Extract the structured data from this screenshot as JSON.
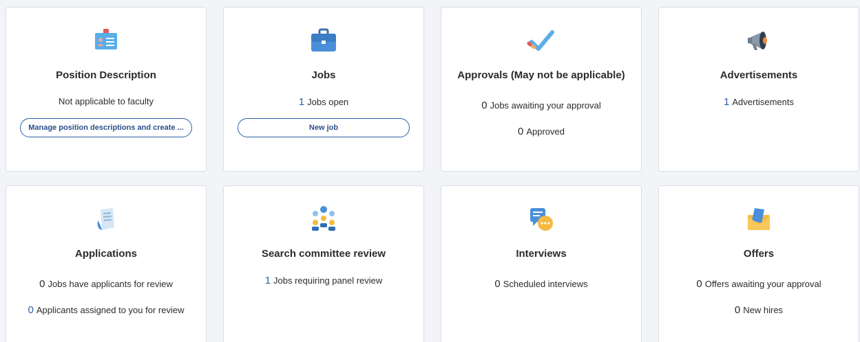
{
  "cards": [
    {
      "icon": "id-card-icon",
      "title": "Position Description",
      "text": "Not applicable to faculty",
      "button": "Manage position descriptions and create ..."
    },
    {
      "icon": "briefcase-icon",
      "title": "Jobs",
      "stat_num": "1",
      "stat_text": "Jobs open",
      "button": "New job"
    },
    {
      "icon": "checkmark-pencil-icon",
      "title": "Approvals (May not be applicable)",
      "stat1_num": "0",
      "stat1_text": "Jobs awaiting your approval",
      "stat2_num": "0",
      "stat2_text": "Approved"
    },
    {
      "icon": "megaphone-icon",
      "title": "Advertisements",
      "stat_num": "1",
      "stat_text": "Advertisements"
    },
    {
      "icon": "documents-icon",
      "title": "Applications",
      "stat1_num": "0",
      "stat1_text": "Jobs have applicants for review",
      "stat2_num": "0",
      "stat2_text": "Applicants assigned to you for review"
    },
    {
      "icon": "committee-icon",
      "title": "Search committee review",
      "stat_num": "1",
      "stat_text": "Jobs requiring panel review"
    },
    {
      "icon": "chat-bubbles-icon",
      "title": "Interviews",
      "stat_num": "0",
      "stat_text": "Scheduled interviews"
    },
    {
      "icon": "envelope-icon",
      "title": "Offers",
      "stat1_num": "0",
      "stat1_text": "Offers awaiting your approval",
      "stat2_num": "0",
      "stat2_text": "New hires"
    }
  ],
  "colors": {
    "link": "#2b5ea7",
    "background": "#f2f4f7",
    "card": "#ffffff"
  }
}
